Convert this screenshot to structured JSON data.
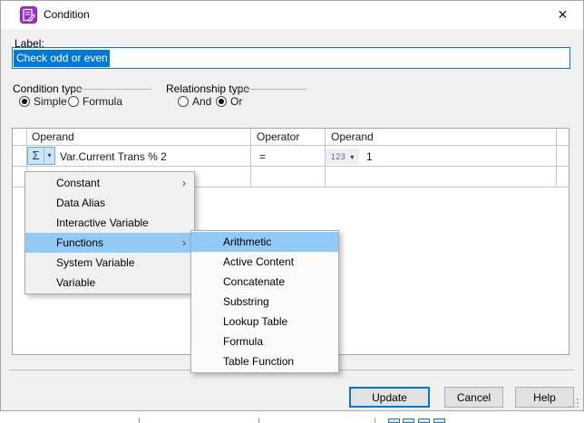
{
  "window": {
    "title": "Condition",
    "close_glyph": "✕"
  },
  "form": {
    "label_caption": "Label:",
    "label_value": "Check odd or even",
    "condition_type": {
      "caption": "Condition type",
      "options": [
        {
          "label": "Simple",
          "selected": true
        },
        {
          "label": "Formula",
          "selected": false
        }
      ]
    },
    "relationship_type": {
      "caption": "Relationship type",
      "options": [
        {
          "label": "And",
          "selected": false
        },
        {
          "label": "Or",
          "selected": true
        }
      ]
    }
  },
  "grid": {
    "headers": [
      "Operand",
      "Operator",
      "Operand"
    ],
    "row1": {
      "sigma_glyph": "Σ",
      "dropdown_glyph": "▾",
      "operand_value": "Var.Current Trans % 2",
      "operator_value": "=",
      "type_label": "123",
      "operand2_value": "1"
    }
  },
  "menu": {
    "arrow_glyph": "›",
    "items": [
      {
        "label": "Constant",
        "submenu": true
      },
      {
        "label": "Data Alias",
        "submenu": false
      },
      {
        "label": "Interactive Variable",
        "submenu": false
      },
      {
        "label": "Functions",
        "submenu": true,
        "highlighted": true
      },
      {
        "label": "System Variable",
        "submenu": false
      },
      {
        "label": "Variable",
        "submenu": false
      }
    ]
  },
  "submenu": {
    "highlighted": "Arithmetic",
    "items": [
      {
        "label": "Arithmetic"
      },
      {
        "label": "Active Content"
      },
      {
        "label": "Concatenate"
      },
      {
        "label": "Substring"
      },
      {
        "label": "Lookup Table"
      },
      {
        "label": "Formula"
      },
      {
        "label": "Table Function"
      }
    ]
  },
  "buttons": {
    "update": "Update",
    "cancel": "Cancel",
    "help": "Help"
  },
  "colors": {
    "accent": "#0078d7",
    "menu_highlight": "#91c9f7",
    "sigma_button_bg": "#cbe5f6"
  }
}
